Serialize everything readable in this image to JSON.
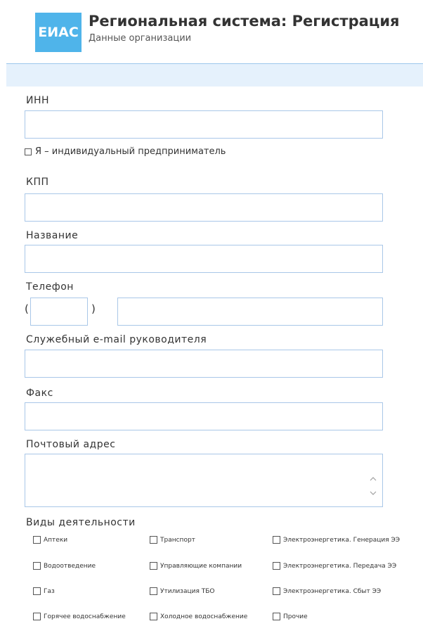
{
  "header": {
    "logo_text": "ЕИАС",
    "title": "Региональная система: Регистрация",
    "subtitle": "Данные организации"
  },
  "form": {
    "inn_label": "ИНН",
    "inn_value": "",
    "individual_label": "Я – индивидуальный предприниматель",
    "kpp_label": "КПП",
    "kpp_value": "",
    "name_label": "Название",
    "name_value": "",
    "phone_label": "Телефон",
    "phone_open_paren": "(",
    "phone_close_paren": ")",
    "phone_code_value": "",
    "phone_number_value": "",
    "email_label": "Служебный e-mail руководителя",
    "email_value": "",
    "fax_label": "Факс",
    "fax_value": "",
    "address_label": "Почтовый адрес",
    "address_value": "",
    "activities_label": "Виды деятельности"
  },
  "activities": [
    [
      "Аптеки",
      "Транспорт",
      "Электроэнергетика. Генерация ЭЭ"
    ],
    [
      "Водоотведение",
      "Управляющие компании",
      "Электроэнергетика. Передача ЭЭ"
    ],
    [
      "Газ",
      "Утилизация ТБО",
      "Электроэнергетика. Сбыт ЭЭ"
    ],
    [
      "Горячее водоснабжение",
      "Холодное водоснабжение",
      "Прочие"
    ]
  ],
  "colors": {
    "logo_bg": "#4fb4ea",
    "band_bg": "#e5f1fc",
    "field_border": "#a9c7e8"
  }
}
